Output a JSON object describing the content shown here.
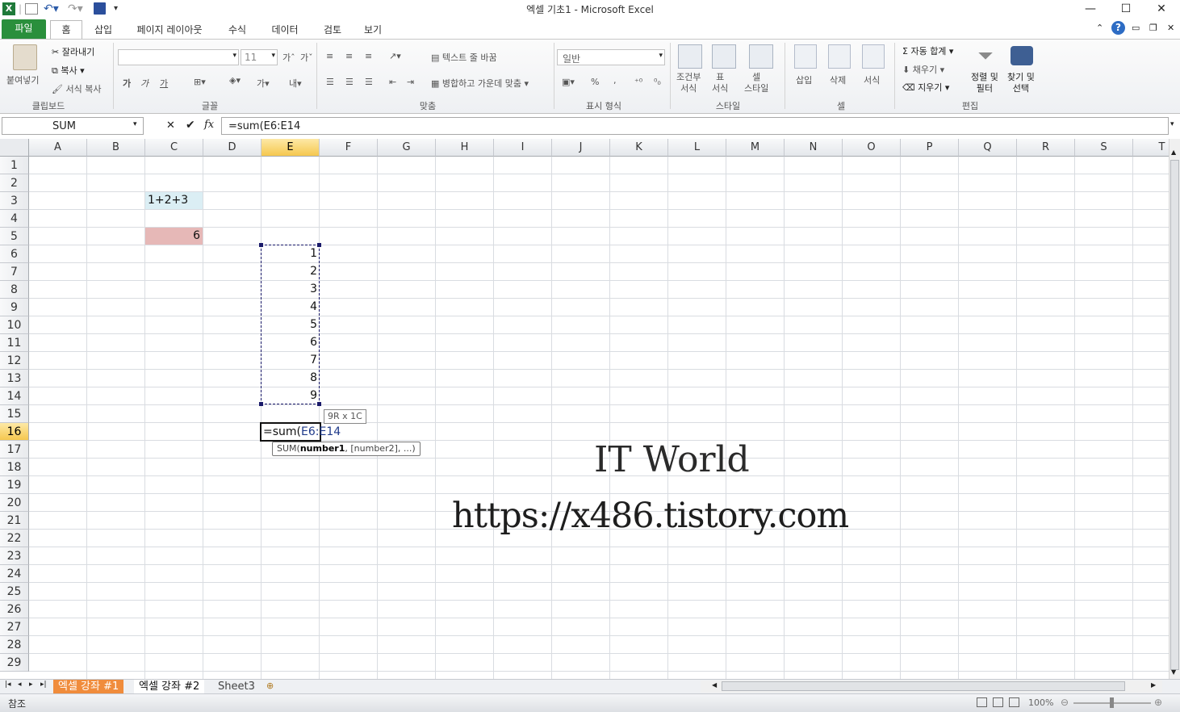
{
  "window": {
    "title": "엑셀 기초1  -  Microsoft Excel"
  },
  "tabs": [
    "파일",
    "홈",
    "삽입",
    "페이지 레이아웃",
    "수식",
    "데이터",
    "검토",
    "보기"
  ],
  "ribbon": {
    "clipboard": {
      "paste": "붙여넣기",
      "cut": "잘라내기",
      "copy": "복사",
      "format_painter": "서식 복사",
      "label": "클립보드"
    },
    "font": {
      "size": "11",
      "label": "글꼴",
      "bold": "가",
      "italic": "가",
      "underline": "가"
    },
    "alignment": {
      "wrap": "텍스트 줄 바꿈",
      "merge": "병합하고 가운데 맞춤",
      "label": "맞춤"
    },
    "number": {
      "format": "일반",
      "label": "표시 형식",
      "percent": "%",
      "comma": ","
    },
    "styles": {
      "conditional": "조건부\n서식",
      "table": "표\n서식",
      "cell_style": "셀\n스타일",
      "label": "스타일"
    },
    "cells": {
      "insert": "삽입",
      "delete": "삭제",
      "format": "서식",
      "label": "셀"
    },
    "editing": {
      "autosum": "자동 합계",
      "fill": "채우기",
      "clear": "지우기",
      "sort": "정렬 및\n필터",
      "find": "찾기 및\n선택",
      "label": "편집"
    }
  },
  "formula_bar": {
    "name_box": "SUM",
    "formula": "=sum(E6:E14"
  },
  "columns": [
    "A",
    "B",
    "C",
    "D",
    "E",
    "F",
    "G",
    "H",
    "I",
    "J",
    "K",
    "L",
    "M",
    "N",
    "O",
    "P",
    "Q",
    "R",
    "S",
    "T"
  ],
  "rows": [
    "1",
    "2",
    "3",
    "4",
    "5",
    "6",
    "7",
    "8",
    "9",
    "10",
    "11",
    "12",
    "13",
    "14",
    "15",
    "16",
    "17",
    "18",
    "19",
    "20",
    "21",
    "22",
    "23",
    "24",
    "25",
    "26",
    "27",
    "28",
    "29"
  ],
  "cells": {
    "C3": "1+2+3",
    "C5": "6",
    "E_values": [
      "1",
      "2",
      "3",
      "4",
      "5",
      "6",
      "7",
      "8",
      "9"
    ],
    "E16": "=sum(E6:E14"
  },
  "range_tooltip": "9R x 1C",
  "function_tip": {
    "name": "SUM(",
    "arg1": "number1",
    "rest": ", [number2], ...)"
  },
  "watermark": {
    "line1": "IT World",
    "line2": "https://x486.tistory.com"
  },
  "sheets": [
    "엑셀 강좌 #1",
    "엑셀 강좌 #2",
    "Sheet3"
  ],
  "status": {
    "mode": "참조",
    "zoom": "100%"
  },
  "colors": {
    "c3_fill": "#dbeef4",
    "c5_fill": "#e6b8b7",
    "active_sheet": "#f08c3c",
    "file_tab": "#2a8f3c"
  }
}
